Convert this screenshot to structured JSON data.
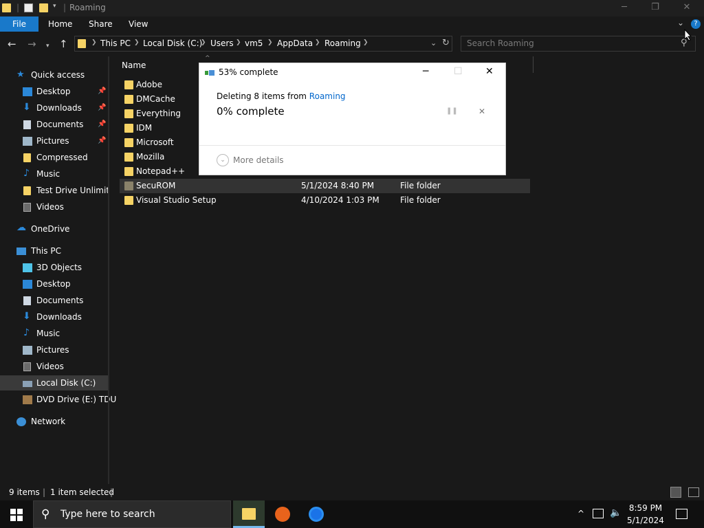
{
  "titlebar": {
    "title": "Roaming",
    "min_icon": "minimize-icon",
    "max_icon": "restore-icon",
    "close_icon": "close-icon"
  },
  "ribbon": {
    "file": "File",
    "home": "Home",
    "share": "Share",
    "view": "View"
  },
  "address": {
    "crumbs": [
      "This PC",
      "Local Disk (C:)",
      "Users",
      "vm5",
      "AppData",
      "Roaming"
    ]
  },
  "search": {
    "placeholder": "Search Roaming"
  },
  "nav": {
    "quick_access": "Quick access",
    "qa_items": [
      "Desktop",
      "Downloads",
      "Documents",
      "Pictures",
      "Compressed",
      "Music",
      "Test Drive Unlimited",
      "Videos"
    ],
    "onedrive": "OneDrive",
    "this_pc": "This PC",
    "pc_items": [
      "3D Objects",
      "Desktop",
      "Documents",
      "Downloads",
      "Music",
      "Pictures",
      "Videos",
      "Local Disk (C:)",
      "DVD Drive (E:) TDU"
    ],
    "network": "Network"
  },
  "list": {
    "col_name": "Name",
    "rows": [
      {
        "name": "Adobe",
        "date": "",
        "type": ""
      },
      {
        "name": "DMCache",
        "date": "",
        "type": ""
      },
      {
        "name": "Everything",
        "date": "",
        "type": ""
      },
      {
        "name": "IDM",
        "date": "",
        "type": ""
      },
      {
        "name": "Microsoft",
        "date": "",
        "type": ""
      },
      {
        "name": "Mozilla",
        "date": "",
        "type": ""
      },
      {
        "name": "Notepad++",
        "date": "",
        "type": ""
      },
      {
        "name": "SecuROM",
        "date": "5/1/2024 8:40 PM",
        "type": "File folder"
      },
      {
        "name": "Visual Studio Setup",
        "date": "4/10/2024 1:03 PM",
        "type": "File folder"
      }
    ]
  },
  "dialog": {
    "title": "53% complete",
    "line_prefix": "Deleting 8 items from",
    "line_link": "Roaming",
    "percent": "0% complete",
    "more": "More details",
    "pause_icon": "pause-icon",
    "cancel_icon": "cancel-icon"
  },
  "status": {
    "count": "9 items",
    "selected": "1 item selected"
  },
  "taskbar": {
    "search": "Type here to search",
    "time": "8:59 PM",
    "date": "5/1/2024"
  },
  "colors": {
    "accent": "#1979ca",
    "folder": "#f6d365",
    "bg": "#191919"
  }
}
